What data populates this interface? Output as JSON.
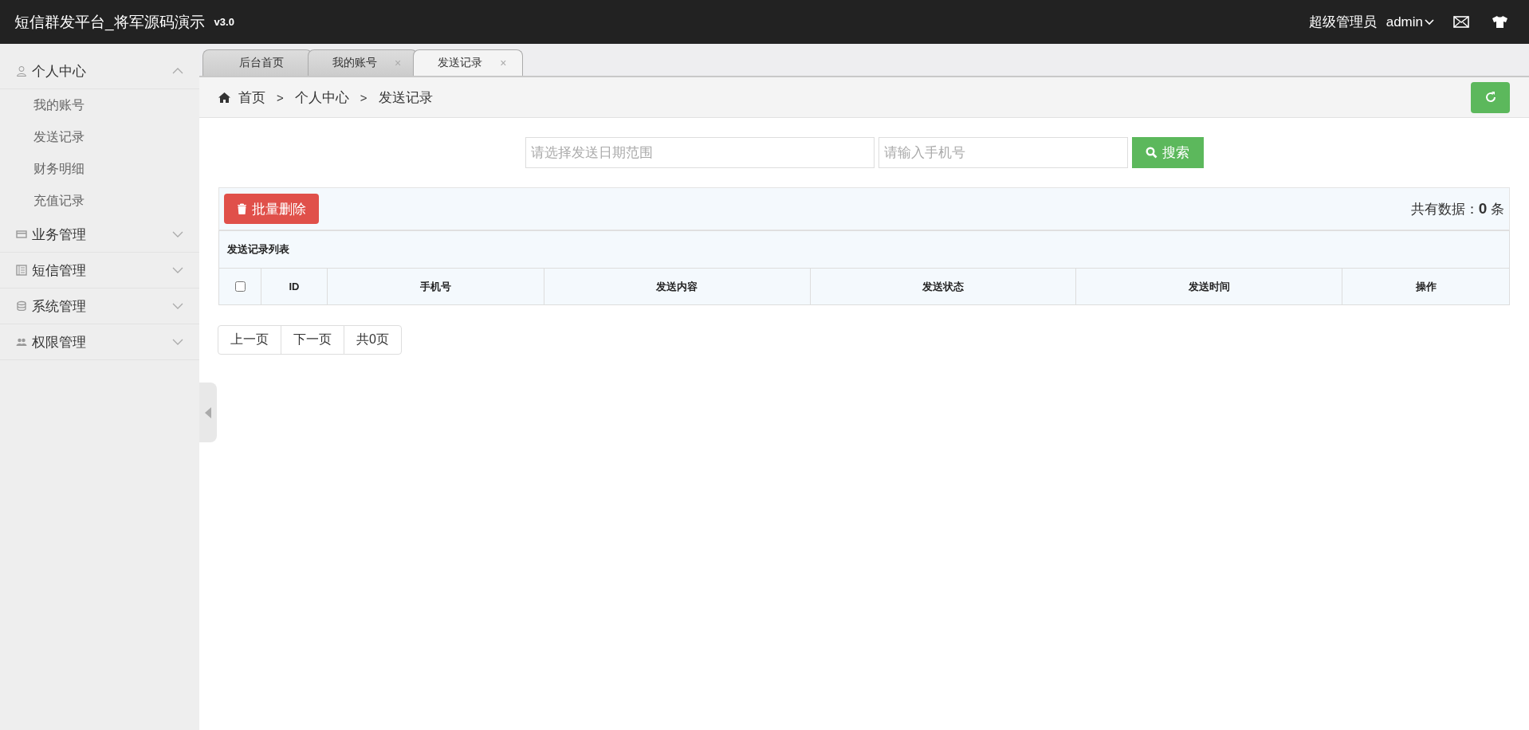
{
  "header": {
    "title": "短信群发平台_将军源码演示",
    "version": "v3.0",
    "role": "超级管理员",
    "user": "admin"
  },
  "sidebar": {
    "groups": [
      {
        "label": "个人中心",
        "expanded": true,
        "children": [
          {
            "label": "我的账号"
          },
          {
            "label": "发送记录"
          },
          {
            "label": "财务明细"
          },
          {
            "label": "充值记录"
          }
        ]
      },
      {
        "label": "业务管理",
        "expanded": false
      },
      {
        "label": "短信管理",
        "expanded": false
      },
      {
        "label": "系统管理",
        "expanded": false
      },
      {
        "label": "权限管理",
        "expanded": false
      }
    ]
  },
  "tabs": [
    {
      "label": "后台首页",
      "selected": false
    },
    {
      "label": "我的账号",
      "close": "×",
      "selected": false
    },
    {
      "label": "发送记录",
      "close": "×",
      "selected": true
    }
  ],
  "breadcrumb": {
    "separator": ">",
    "items": [
      "首页",
      "个人中心",
      "发送记录"
    ]
  },
  "search": {
    "date_placeholder": "请选择发送日期范围",
    "phone_placeholder": "请输入手机号",
    "button": "搜索"
  },
  "toolbar": {
    "delete_button": "批量删除",
    "total": "共有数据：**0** 条"
  },
  "table": {
    "caption": "发送记录列表",
    "checked": false,
    "columns": [
      "ID",
      "手机号",
      "发送内容",
      "发送状态",
      "发送时间",
      "操作"
    ]
  },
  "pagination": [
    "上一页",
    "下一页",
    "共0页"
  ]
}
